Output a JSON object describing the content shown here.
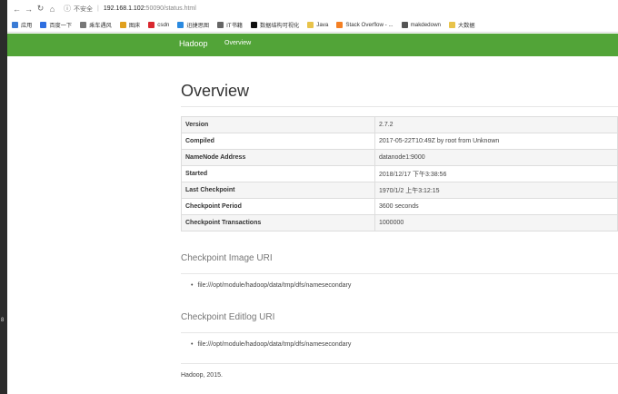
{
  "browser": {
    "insecure_label": "不安全",
    "url_host": "192.168.1.102:",
    "url_rest": "50090/status.html",
    "bookmarks": [
      {
        "label": "应用",
        "color": "#3a7bd5",
        "icon": "apps-icon"
      },
      {
        "label": "百度一下",
        "color": "#2f6fe0",
        "icon": "baidu-icon"
      },
      {
        "label": "乘车遇风",
        "color": "#777777",
        "icon": "cloud-icon"
      },
      {
        "label": "图床",
        "color": "#e0a01e",
        "icon": "image-icon"
      },
      {
        "label": "csdn",
        "color": "#d9282f",
        "icon": "csdn-icon"
      },
      {
        "label": "迅捷思图",
        "color": "#2b8ae0",
        "icon": "mindmap-icon"
      },
      {
        "label": "IT书籍",
        "color": "#666666",
        "icon": "book-icon"
      },
      {
        "label": "数据结构可视化",
        "color": "#111111",
        "icon": "ds-icon"
      },
      {
        "label": "Java",
        "color": "#e8c34a",
        "icon": "folder-icon"
      },
      {
        "label": "Stack Overflow - ...",
        "color": "#f48024",
        "icon": "stackoverflow-icon"
      },
      {
        "label": "makdedown",
        "color": "#555555",
        "icon": "github-icon"
      },
      {
        "label": "大数据",
        "color": "#e8c34a",
        "icon": "folder-icon"
      }
    ]
  },
  "navbar": {
    "brand": "Hadoop",
    "link": "Overview",
    "color": "#52a438"
  },
  "main": {
    "title": "Overview",
    "rows": [
      {
        "key": "Version",
        "value": "2.7.2"
      },
      {
        "key": "Compiled",
        "value": "2017-05-22T10:49Z by root from Unknown"
      },
      {
        "key": "NameNode Address",
        "value": "datanode1:9000"
      },
      {
        "key": "Started",
        "value": "2018/12/17 下午3:38:56"
      },
      {
        "key": "Last Checkpoint",
        "value": "1970/1/2 上午3:12:15"
      },
      {
        "key": "Checkpoint Period",
        "value": "3600 seconds"
      },
      {
        "key": "Checkpoint Transactions",
        "value": "1000000"
      }
    ],
    "image_uri_heading": "Checkpoint Image URI",
    "image_uri": "file:///opt/module/hadoop/data/tmp/dfs/namesecondary",
    "editlog_uri_heading": "Checkpoint Editlog URI",
    "editlog_uri": "file:///opt/module/hadoop/data/tmp/dfs/namesecondary",
    "footer": "Hadoop, 2015."
  }
}
